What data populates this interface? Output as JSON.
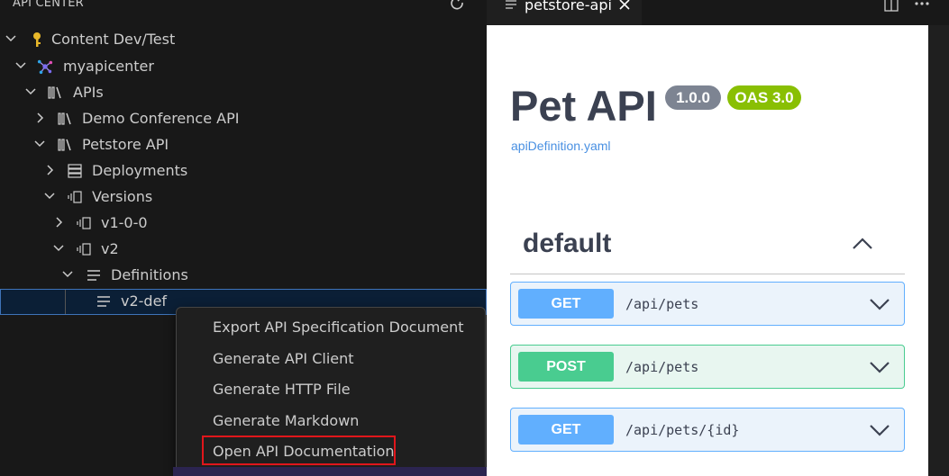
{
  "sidebar": {
    "title": "API CENTER",
    "tree": [
      {
        "label": "Content Dev/Test",
        "icon": "key-icon"
      },
      {
        "label": "myapicenter",
        "icon": "api-center-icon"
      },
      {
        "label": "APIs",
        "icon": "library-icon"
      },
      {
        "label": "Demo Conference API",
        "icon": "library-icon"
      },
      {
        "label": "Petstore API",
        "icon": "library-icon"
      },
      {
        "label": "Deployments",
        "icon": "server-icon"
      },
      {
        "label": "Versions",
        "icon": "versions-icon"
      },
      {
        "label": "v1-0-0",
        "icon": "versions-icon"
      },
      {
        "label": "v2",
        "icon": "versions-icon"
      },
      {
        "label": "Definitions",
        "icon": "list-icon"
      },
      {
        "label": "v2-def",
        "icon": "list-icon"
      }
    ]
  },
  "context_menu": {
    "items": [
      "Export API Specification Document",
      "Generate API Client",
      "Generate HTTP File",
      "Generate Markdown",
      "Open API Documentation"
    ],
    "highlight_color": "#e0161b"
  },
  "editor": {
    "tab_label": "petstore-api",
    "title": "Pet API",
    "version_badge": "1.0.0",
    "oas_badge": "OAS 3.0",
    "definition_link": "apiDefinition.yaml",
    "section": "default",
    "operations": [
      {
        "method": "GET",
        "path": "/api/pets"
      },
      {
        "method": "POST",
        "path": "/api/pets"
      },
      {
        "method": "GET",
        "path": "/api/pets/{id}"
      }
    ]
  },
  "colors": {
    "get": "#61affe",
    "post": "#49cc90",
    "selection_border": "#3e73b8"
  }
}
